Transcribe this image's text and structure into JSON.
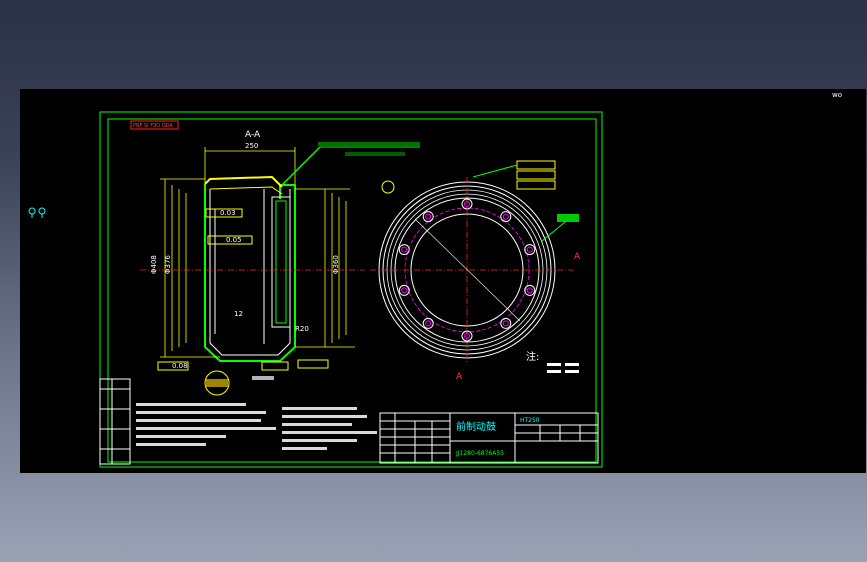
{
  "view": {
    "corner_glyph": "wo",
    "ucs_glyphs": [
      "Q",
      "Q"
    ]
  },
  "sheet": {
    "top_tag": "PRF SI F9O ODA",
    "section_title": "A-A",
    "note_header": "注:",
    "title_block": {
      "part_name": "前制动鼓",
      "drawing_number": "JJ1280-6876A55",
      "material_code": "HT250"
    },
    "colors": {
      "frame": "#00ff00",
      "outline": "#ffffff",
      "dimension": "#ffff00",
      "centerline": "#ff2020",
      "annotation": "#00ffff",
      "hidden": "#ff00ff"
    }
  },
  "labels": {
    "section_marker_right": "A",
    "section_marker_bottom": "A",
    "dim_phi_408": "Φ408",
    "dim_phi_376": "Φ376",
    "dim_phi_360": "Φ360",
    "dim_12": "12",
    "dim_250": "250",
    "dim_R20": "R20",
    "tolerance_1": "0.03",
    "tolerance_2": "0.05",
    "tolerance_3": "0.08"
  }
}
